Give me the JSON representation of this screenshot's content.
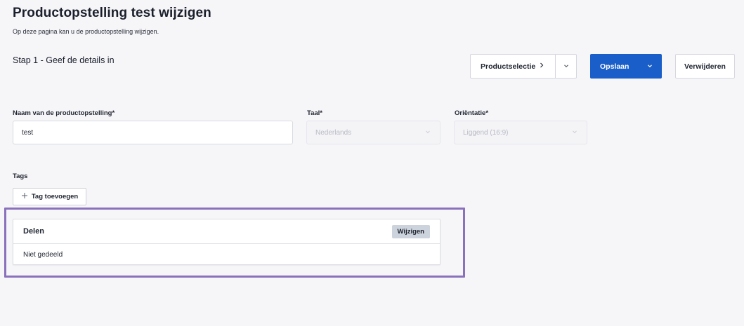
{
  "page": {
    "title": "Productopstelling test wijzigen",
    "subtitle": "Op deze pagina kan u de productopstelling wijzigen.",
    "step_title": "Stap 1 - Geef de details in"
  },
  "actions": {
    "product_selection_label": "Productselectie",
    "save_label": "Opslaan",
    "delete_label": "Verwijderen"
  },
  "form": {
    "name": {
      "label": "Naam van de productopstelling*",
      "value": "test"
    },
    "language": {
      "label": "Taal*",
      "value": "Nederlands"
    },
    "orientation": {
      "label": "Oriëntatie*",
      "value": "Liggend (16:9)"
    }
  },
  "tags": {
    "label": "Tags",
    "add_button_label": "Tag toevoegen"
  },
  "share": {
    "title": "Delen",
    "edit_button_label": "Wijzigen",
    "status": "Niet gedeeld"
  },
  "colors": {
    "primary": "#1a5ec9",
    "highlight": "#8a71bb",
    "background": "#f6f6f9"
  },
  "icons": {
    "chevron_right": "chevron-right-icon",
    "chevron_down": "chevron-down-icon",
    "plus": "plus-icon"
  }
}
